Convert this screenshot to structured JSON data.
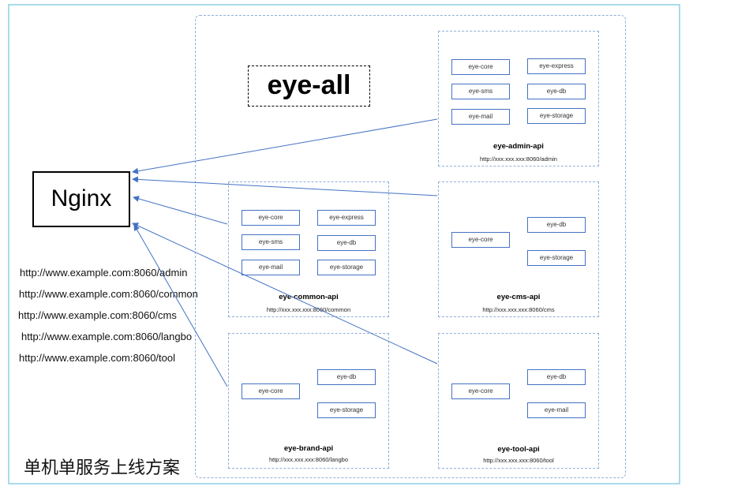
{
  "title": "eye-all",
  "nginx": "Nginx",
  "caption": "单机单服务上线方案",
  "routes": [
    "http://www.example.com:8060/admin",
    "http://www.example.com:8060/common",
    "http://www.example.com:8060/cms",
    "http://www.example.com:8060/langbo",
    "http://www.example.com:8060/tool"
  ],
  "services": {
    "admin": {
      "name": "eye-admin-api",
      "url": "http://xxx.xxx.xxx:8060/admin",
      "modules": [
        "eye-core",
        "eye-express",
        "eye-sms",
        "eye-db",
        "eye-mail",
        "eye-storage"
      ]
    },
    "common": {
      "name": "eye-common-api",
      "url": "http://xxx.xxx.xxx:8060/common",
      "modules": [
        "eye-core",
        "eye-express",
        "eye-sms",
        "eye-db",
        "eye-mail",
        "eye-storage"
      ]
    },
    "cms": {
      "name": "eye-cms-api",
      "url": "http://xxx.xxx.xxx:8060/cms",
      "modules": [
        "eye-core",
        "eye-db",
        "eye-storage"
      ]
    },
    "brand": {
      "name": "eye-brand-api",
      "url": "http://xxx.xxx.xxx:8060/langbo",
      "modules": [
        "eye-core",
        "eye-db",
        "eye-storage"
      ]
    },
    "tool": {
      "name": "eye-tool-api",
      "url": "http://xxx.xxx.xxx:8060/tool",
      "modules": [
        "eye-core",
        "eye-db",
        "eye-mail"
      ]
    }
  },
  "colors": {
    "arrow": "#4472c4",
    "module_border": "#4472c4",
    "frame": "#a9dbea",
    "dashed": "#8fb0d8"
  }
}
